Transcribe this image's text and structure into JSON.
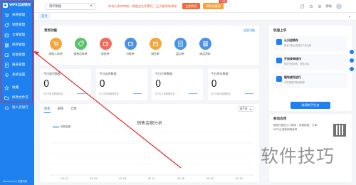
{
  "sidebar": {
    "app_name": "WPS云进销存",
    "items": [
      {
        "label": "采购管理",
        "icon": "cart-icon"
      },
      {
        "label": "销售管理",
        "icon": "tag-icon"
      },
      {
        "label": "仓库管理",
        "icon": "box-icon"
      },
      {
        "label": "库存管理",
        "icon": "stack-icon"
      },
      {
        "label": "资金管理",
        "icon": "wallet-icon"
      },
      {
        "label": "报表管理",
        "icon": "report-icon"
      },
      {
        "label": "系统设置",
        "icon": "gear-icon"
      }
    ],
    "extra": [
      {
        "label": "收藏",
        "icon": "star-icon"
      },
      {
        "label": "修改文件夹",
        "icon": "folder-icon"
      },
      {
        "label": "进入云进行",
        "icon": "cloud-icon"
      }
    ],
    "powered": "Powered by 讯盟科技"
  },
  "topbar": {
    "account_select": "演示数据",
    "notice": "你有九条待审核，数据会在积累后，正式使用前清除",
    "btn_primary": "立即购买",
    "btn_secondary": "领取优惠券",
    "btn_secondary_badge": "可领取",
    "username": "帮助"
  },
  "breadcrumb": {
    "tab": "首页"
  },
  "common": {
    "title": "常用功能",
    "link": "全部功能",
    "items": [
      {
        "label": "采购入库单",
        "color": "#f6a53a"
      },
      {
        "label": "销售出库单",
        "color": "#5bc26b"
      },
      {
        "label": "收款单",
        "color": "#f06b5a"
      },
      {
        "label": "付款单",
        "color": "#4a90e8"
      },
      {
        "label": "调货单",
        "color": "#f6a53a"
      },
      {
        "label": "盘点单",
        "color": "#4a90e8"
      },
      {
        "label": "商品资料",
        "color": "#4a90e8"
      }
    ]
  },
  "stats": [
    {
      "title": "今日收货数据",
      "value": "0",
      "delta": "近7天收货数据变化"
    },
    {
      "title": "今日出库数据",
      "value": "0",
      "delta": "近7天出库数据变化"
    },
    {
      "title": "今日订单数据",
      "value": "0",
      "delta": "近7天订单数据变化"
    },
    {
      "title": "今日库存数据",
      "value": "0",
      "delta": "近7天库存数据变化"
    }
  ],
  "analysis": {
    "tabs": [
      "销售",
      "采购",
      "仓库"
    ],
    "period": "近7天"
  },
  "chart_data": {
    "type": "bar",
    "title": "销售金额分析",
    "legend": [
      "销售金额"
    ],
    "categories": [
      "05-24",
      "05-25",
      "05-26",
      "05-27",
      "05-28",
      "05-29",
      "05-30"
    ],
    "series": [
      {
        "name": "销售金额",
        "values": [
          0,
          0,
          0,
          0,
          0,
          0,
          0
        ]
      }
    ],
    "grid": true
  },
  "quickstart": {
    "title": "快速上手",
    "items": [
      {
        "title": "认识进销存",
        "sub": "快速了解云进销存产品功能"
      },
      {
        "title": "开始录单操作",
        "sub": "轻松完成采购、销售录单"
      },
      {
        "title": "随地使用进行",
        "sub": "手机端随时随地管理"
      }
    ],
    "button": "继续新手任务"
  },
  "mobile": {
    "title": "移动应用",
    "text": "微信扫描进入小程序，查看报表、订单，WPS云进销存随身带"
  },
  "watermark": "软件技巧"
}
